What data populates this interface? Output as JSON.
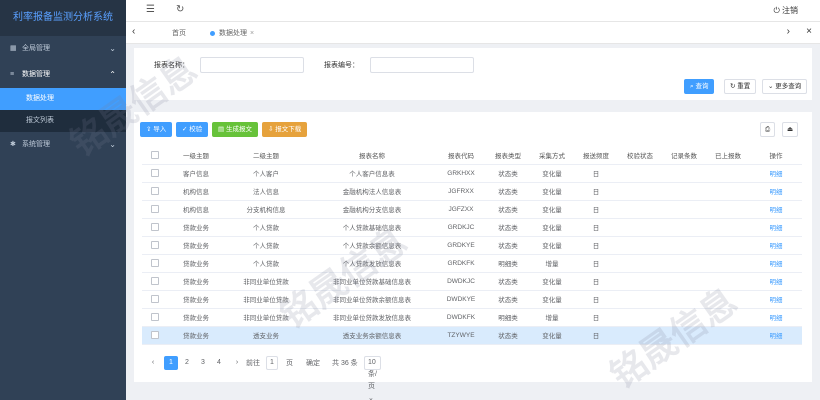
{
  "app": {
    "title": "利率报备监测分析系统"
  },
  "sidebar": {
    "items": [
      {
        "label": "全局管理",
        "icon": "grid-icon",
        "chevron": "⌄"
      },
      {
        "label": "数据管理",
        "icon": "list-icon",
        "chevron": "⌃",
        "children": [
          {
            "label": "数据处理",
            "active": true
          },
          {
            "label": "报文列表"
          }
        ]
      },
      {
        "label": "系统管理",
        "icon": "gear-icon",
        "chevron": "⌄"
      }
    ]
  },
  "navbar": {
    "menu_icon": "☰",
    "refresh_icon": "↻",
    "logout_label": "注销"
  },
  "tags": {
    "home": "首页",
    "current": "数据处理"
  },
  "search": {
    "report_name_label": "报表名称：",
    "report_code_label": "报表编号：",
    "query": "查询",
    "reset": "重置",
    "more": "更多查询"
  },
  "toolbar": {
    "import": "导入",
    "verify": "校验",
    "generate": "生成报文",
    "export": "报文下载"
  },
  "table": {
    "headers": [
      "",
      "一级主题",
      "二级主题",
      "报表名称",
      "报表代码",
      "报表类型",
      "采集方式",
      "报送频度",
      "校验状态",
      "记录条数",
      "已上报数",
      "操作"
    ],
    "rows": [
      [
        "客户信息",
        "个人客户",
        "个人客户信息表",
        "GRKHXX",
        "状态类",
        "变化量",
        "日",
        "",
        "",
        "",
        "明细"
      ],
      [
        "机构信息",
        "法人信息",
        "金融机构法人信息表",
        "JGFRXX",
        "状态类",
        "变化量",
        "日",
        "",
        "",
        "",
        "明细"
      ],
      [
        "机构信息",
        "分支机构信息",
        "金融机构分支信息表",
        "JGFZXX",
        "状态类",
        "变化量",
        "日",
        "",
        "",
        "",
        "明细"
      ],
      [
        "贷款业务",
        "个人贷款",
        "个人贷款基础信息表",
        "GRDKJC",
        "状态类",
        "变化量",
        "日",
        "",
        "",
        "",
        "明细"
      ],
      [
        "贷款业务",
        "个人贷款",
        "个人贷款余额信息表",
        "GRDKYE",
        "状态类",
        "变化量",
        "日",
        "",
        "",
        "",
        "明细"
      ],
      [
        "贷款业务",
        "个人贷款",
        "个人贷款发放信息表",
        "GRDKFK",
        "明细类",
        "增量",
        "日",
        "",
        "",
        "",
        "明细"
      ],
      [
        "贷款业务",
        "非同业单位贷款",
        "非同业单位贷款基础信息表",
        "DWDKJC",
        "状态类",
        "变化量",
        "日",
        "",
        "",
        "",
        "明细"
      ],
      [
        "贷款业务",
        "非同业单位贷款",
        "非同业单位贷款余额信息表",
        "DWDKYE",
        "状态类",
        "变化量",
        "日",
        "",
        "",
        "",
        "明细"
      ],
      [
        "贷款业务",
        "非同业单位贷款",
        "非同业单位贷款发放信息表",
        "DWDKFK",
        "明细类",
        "增量",
        "日",
        "",
        "",
        "",
        "明细"
      ],
      [
        "贷款业务",
        "透支业务",
        "透支业务余额信息表",
        "TZYWYE",
        "状态类",
        "变化量",
        "日",
        "",
        "",
        "",
        "明细"
      ]
    ],
    "highlighted_row": 9
  },
  "pager": {
    "prev": "‹",
    "pages": [
      "1",
      "2",
      "3",
      "4"
    ],
    "next": "›",
    "goto_label": "前往",
    "goto_value": "1",
    "goto_unit": "页",
    "confirm": "确定",
    "total": "共 36 条",
    "page_size": "10 条/页"
  },
  "watermark": "铭晟信息",
  "colors": {
    "primary": "#409eff",
    "sidebar_bg": "#304156",
    "success": "#67c23a",
    "warning": "#e6a23c",
    "highlight_row": "#d9ebfd"
  }
}
